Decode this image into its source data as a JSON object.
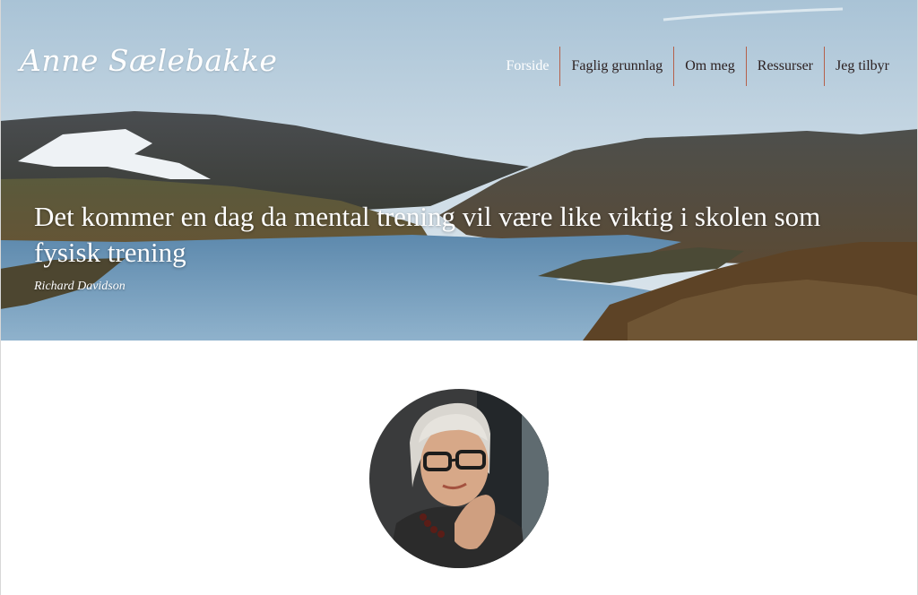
{
  "site": {
    "logo_text": "Anne Sælebakke"
  },
  "nav": {
    "items": [
      {
        "label": "Forside",
        "active": true
      },
      {
        "label": "Faglig grunnlag",
        "active": false
      },
      {
        "label": "Om meg",
        "active": false
      },
      {
        "label": "Ressurser",
        "active": false
      },
      {
        "label": "Jeg tilbyr",
        "active": false
      }
    ],
    "active_color": "#ffffff",
    "text_color": "#2b1f1f",
    "separator_color": "#b5604a"
  },
  "hero": {
    "quote": "Det kommer en dag da mental trening vil være like viktig i skolen som fysisk trening",
    "author": "Richard Davidson"
  },
  "portrait": {
    "icon": "portrait-photo"
  }
}
